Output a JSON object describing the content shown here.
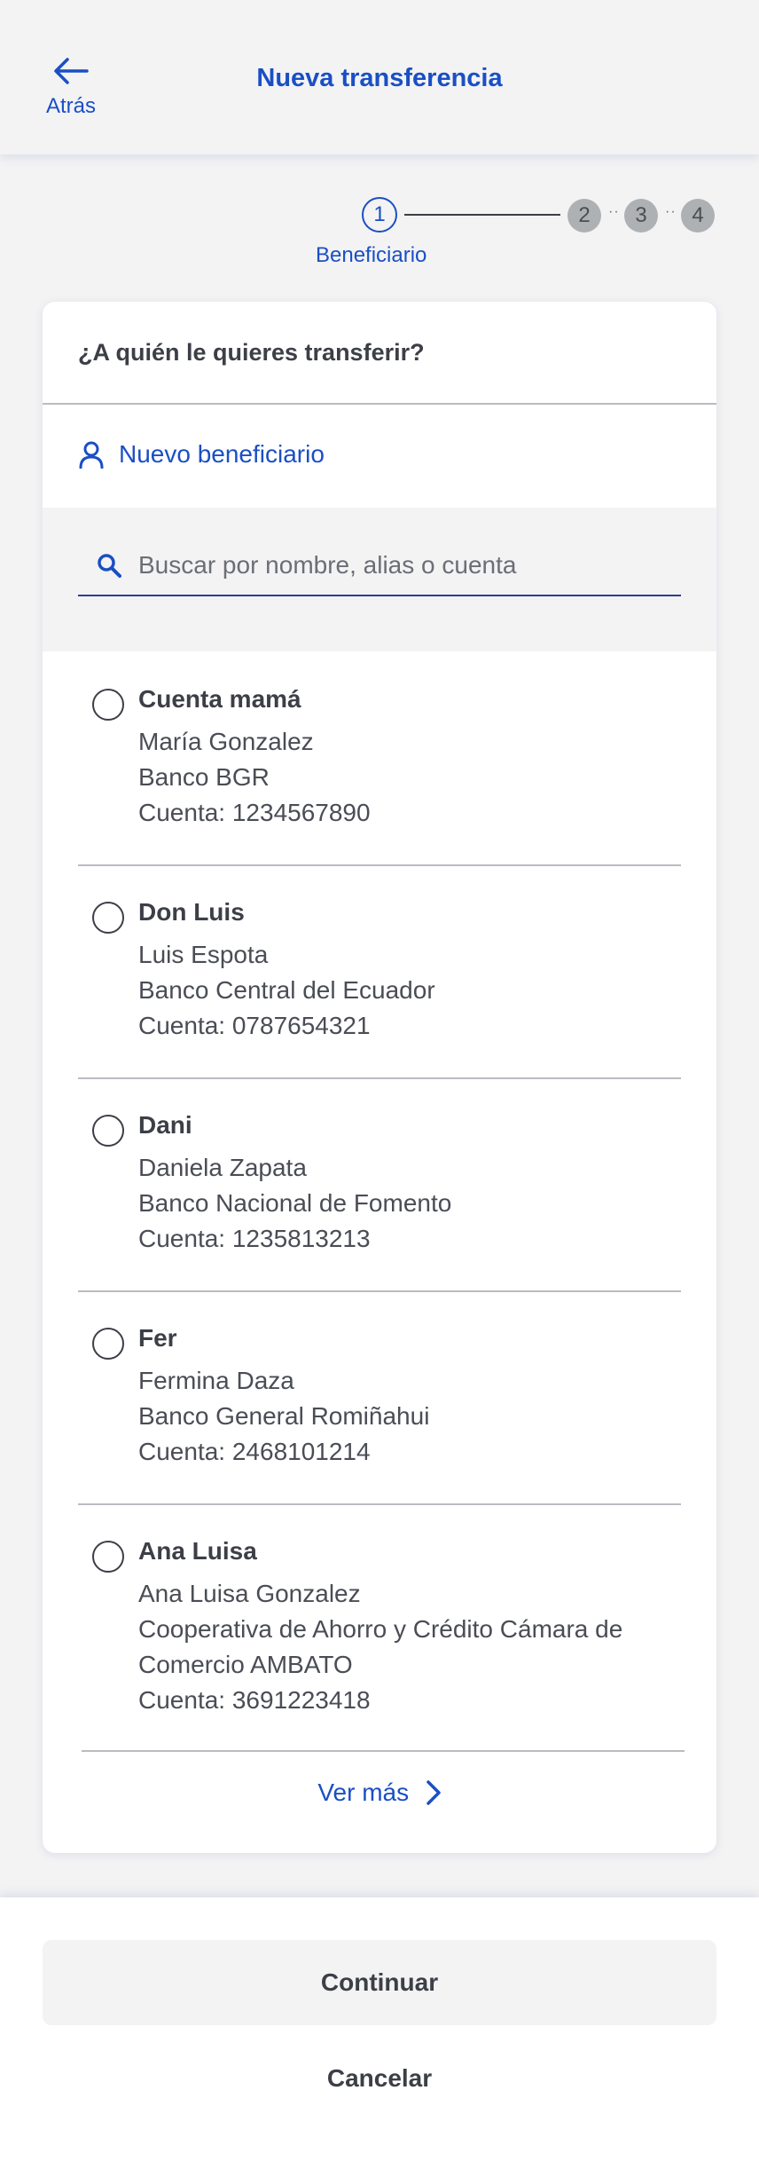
{
  "header": {
    "back_label": "Atrás",
    "title": "Nueva transferencia"
  },
  "stepper": {
    "current_step": "1",
    "current_label": "Beneficiario",
    "steps": [
      "2",
      "3",
      "4"
    ]
  },
  "card": {
    "question": "¿A quién le quieres transferir?",
    "new_beneficiary_label": "Nuevo beneficiario",
    "search_placeholder": "Buscar por nombre, alias o cuenta",
    "beneficiaries": [
      {
        "alias": "Cuenta mamá",
        "name": "María Gonzalez",
        "bank": "Banco BGR",
        "account": "Cuenta: 1234567890"
      },
      {
        "alias": "Don Luis",
        "name": "Luis Espota",
        "bank": "Banco Central del Ecuador",
        "account": "Cuenta: 0787654321"
      },
      {
        "alias": "Dani",
        "name": "Daniela Zapata",
        "bank": "Banco Nacional de Fomento",
        "account": "Cuenta: 1235813213"
      },
      {
        "alias": "Fer",
        "name": "Fermina Daza",
        "bank": "Banco General Romiñahui",
        "account": "Cuenta: 2468101214"
      },
      {
        "alias": "Ana Luisa",
        "name": "Ana Luisa Gonzalez",
        "bank_line1": "Cooperativa de Ahorro y Crédito Cámara de",
        "bank_line2": "Comercio AMBATO",
        "account": "Cuenta: 3691223418"
      }
    ],
    "see_more_label": "Ver más"
  },
  "footer": {
    "continue_label": "Continuar",
    "cancel_label": "Cancelar"
  },
  "colors": {
    "accent": "#1a4fc4",
    "text": "#3d3f47",
    "background": "#f3f3f4",
    "step_inactive": "#aeb1b4"
  }
}
